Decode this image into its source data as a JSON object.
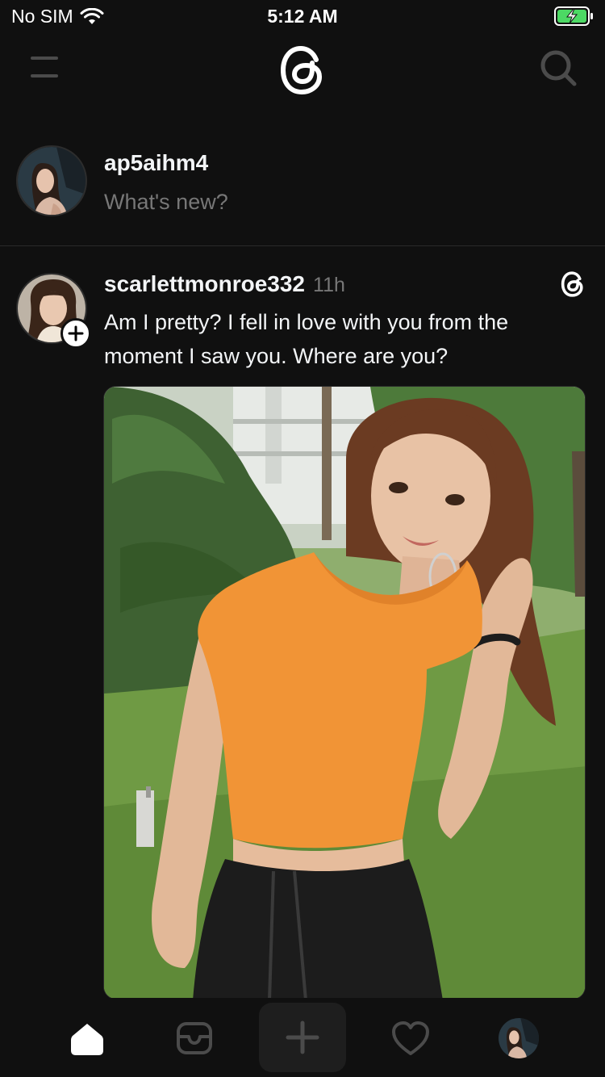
{
  "status_bar": {
    "carrier": "No SIM",
    "time": "5:12 AM"
  },
  "top_nav": {
    "menu_icon": "hamburger-icon",
    "logo_icon": "threads-logo-icon",
    "search_icon": "search-icon"
  },
  "composer": {
    "username": "ap5aihm4",
    "placeholder": "What's new?"
  },
  "post": {
    "username": "scarlettmonroe332",
    "time": "11h",
    "text": "Am I pretty? I fell in love with you from the moment I saw you. Where are you?",
    "follow_icon": "plus-icon",
    "badge_icon": "threads-icon"
  },
  "tab_bar": {
    "items": [
      {
        "icon": "home-icon",
        "active": true
      },
      {
        "icon": "inbox-icon",
        "active": false
      },
      {
        "icon": "plus-icon",
        "active": false
      },
      {
        "icon": "heart-icon",
        "active": false
      },
      {
        "icon": "profile-avatar",
        "active": false
      }
    ]
  },
  "colors": {
    "background": "#101010",
    "text_primary": "#f3f5f7",
    "text_secondary": "#777777",
    "accent_icon": "#4b4b4b"
  }
}
